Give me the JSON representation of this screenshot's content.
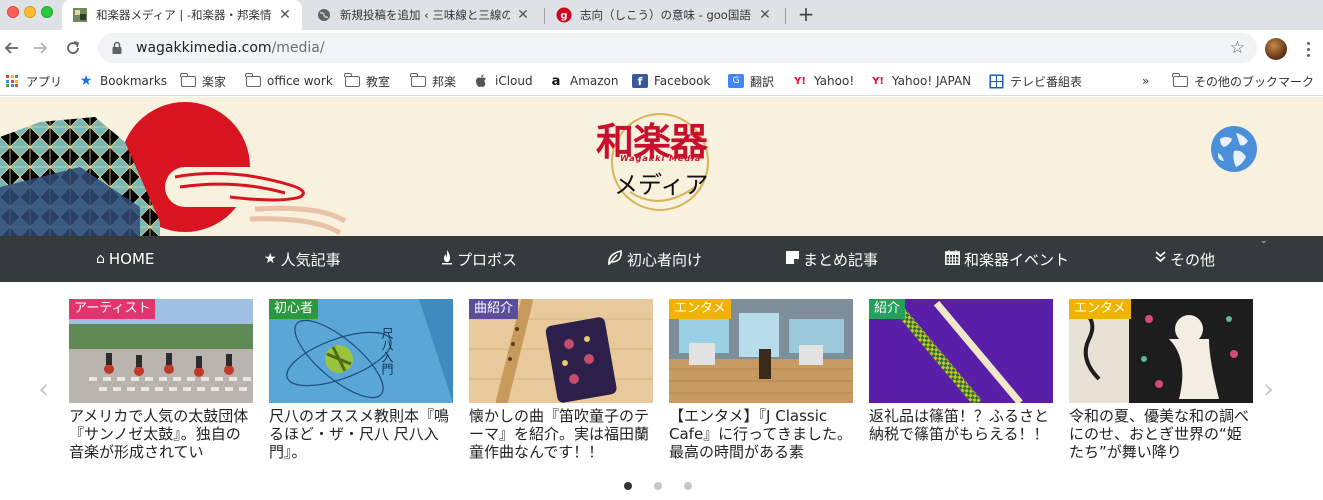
{
  "browser": {
    "tabs": [
      {
        "title": "和楽器メディア | -和楽器・邦楽情",
        "active": true
      },
      {
        "title": "新規投稿を追加 ‹ 三味線と三線の",
        "active": false
      },
      {
        "title": "志向（しこう）の意味 - goo国語",
        "active": false
      }
    ],
    "new_tab_label": "+",
    "url_host": "wagakkimedia.com",
    "url_path": "/media/",
    "bookmarks": [
      {
        "label": "アプリ",
        "icon": "apps-grid-icon"
      },
      {
        "label": "Bookmarks",
        "icon": "star-icon"
      },
      {
        "label": "楽家",
        "icon": "folder-icon"
      },
      {
        "label": "office work",
        "icon": "folder-icon"
      },
      {
        "label": "教室",
        "icon": "folder-icon"
      },
      {
        "label": "邦楽",
        "icon": "folder-icon"
      },
      {
        "label": "iCloud",
        "icon": "apple-icon"
      },
      {
        "label": "Amazon",
        "icon": "amazon-icon"
      },
      {
        "label": "Facebook",
        "icon": "facebook-icon"
      },
      {
        "label": "翻訳",
        "icon": "translate-icon"
      },
      {
        "label": "Yahoo!",
        "icon": "yahoo-icon"
      },
      {
        "label": "Yahoo! JAPAN",
        "icon": "yahoo-icon"
      },
      {
        "label": "テレビ番組表",
        "icon": "tv-guide-icon"
      }
    ],
    "more_label": "»",
    "other_bookmarks": "その他のブックマーク"
  },
  "site": {
    "logo_main": "和楽器",
    "logo_sub": "Wagakki Media",
    "logo_kana": "メディア",
    "nav": [
      {
        "label": "HOME",
        "icon": "home-icon",
        "glyph": "⌂"
      },
      {
        "label": "人気記事",
        "icon": "star-icon",
        "glyph": "★"
      },
      {
        "label": "プロポス",
        "icon": "fire-icon",
        "glyph": "🔥"
      },
      {
        "label": "初心者向け",
        "icon": "leaf-icon",
        "glyph": "❦"
      },
      {
        "label": "まとめ記事",
        "icon": "note-icon",
        "glyph": "▇"
      },
      {
        "label": "和楽器イベント",
        "icon": "calendar-icon",
        "glyph": "▦"
      },
      {
        "label": "その他",
        "icon": "double-chevron-down-icon",
        "glyph": "»"
      }
    ],
    "nav_caret": "⌄",
    "carousel": {
      "prev": "‹",
      "next": "›",
      "cards": [
        {
          "category": "アーティスト",
          "cat_color": "#e5336e",
          "caption": "アメリカで人気の太鼓団体『サンノゼ太鼓』。独自の音楽が形成されてい"
        },
        {
          "category": "初心者",
          "cat_color": "#2b9a3e",
          "caption": "尺八のオススメ教則本『鳴るほど・ザ・尺八 尺八入門』。"
        },
        {
          "category": "曲紹介",
          "cat_color": "#5a4e9c",
          "caption": "懐かしの曲『笛吹童子のテーマ』を紹介。実は福田蘭童作曲なんです！！"
        },
        {
          "category": "エンタメ",
          "cat_color": "#f0b400",
          "caption": "【エンタメ】『J Classic Cafe』に行ってきました。最高の時間がある素"
        },
        {
          "category": "紹介",
          "cat_color": "#23a05a",
          "caption": "返礼品は篠笛！？ふるさと納税で篠笛がもらえる！！"
        },
        {
          "category": "エンタメ",
          "cat_color": "#f0b400",
          "caption": "令和の夏、優美な和の調べにのせ、おとぎ世界の“姫たち”が舞い降り"
        }
      ],
      "pages": 3,
      "active_page": 0
    }
  },
  "colors": {
    "header_bg": "#f7f1dd",
    "nav_bg": "#353b3b",
    "logo_red": "#c8102e"
  }
}
